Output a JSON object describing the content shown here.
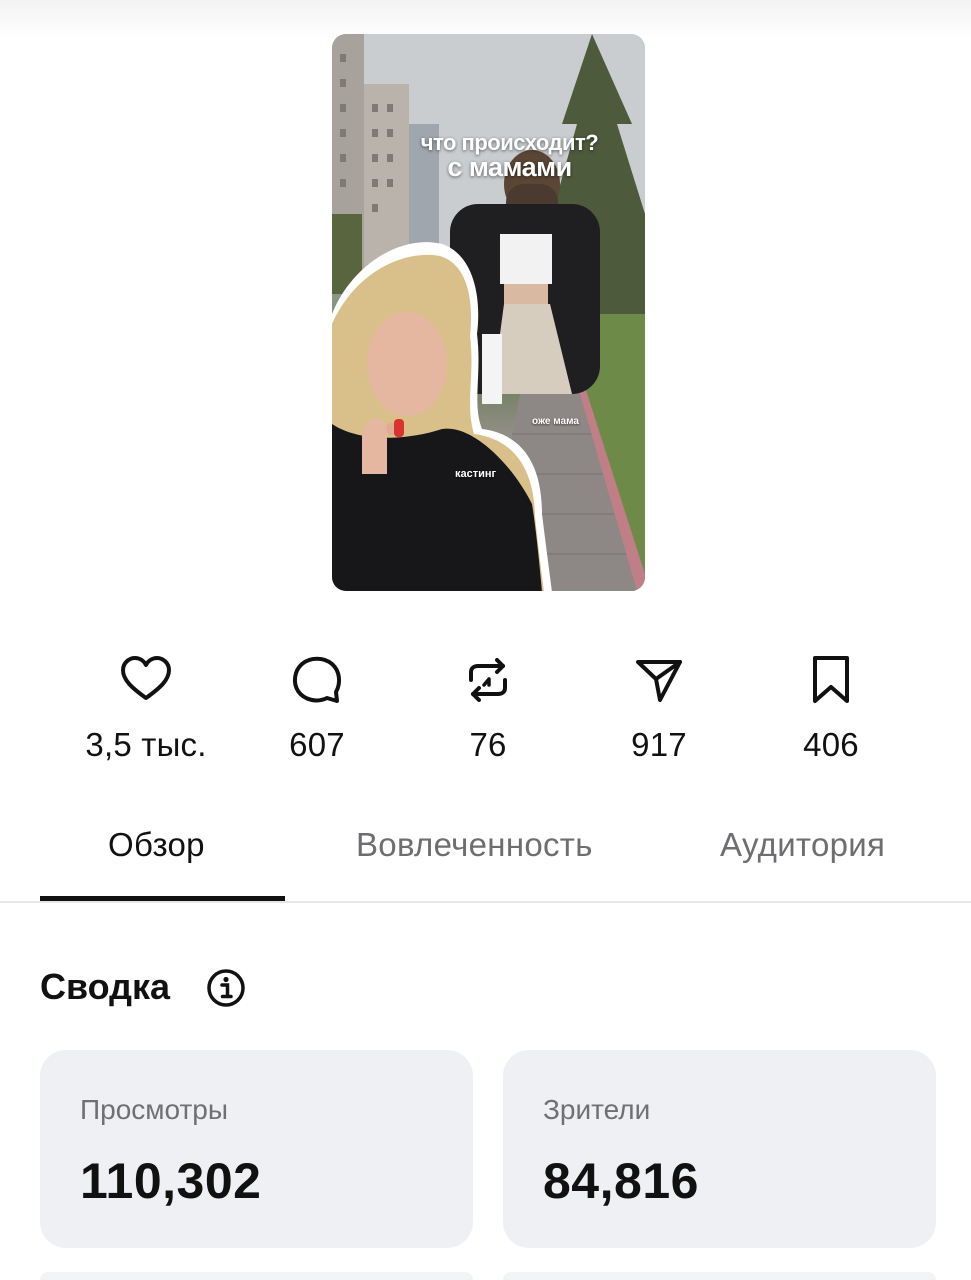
{
  "thumbnail": {
    "caption_line1": "что происходит?",
    "caption_line2": "с мамами",
    "overlay_text_casting": "кастинг",
    "overlay_text_partial": "оже мама"
  },
  "stats": [
    {
      "icon": "heart-icon",
      "value": "3,5 тыс."
    },
    {
      "icon": "comment-icon",
      "value": "607"
    },
    {
      "icon": "repost-icon",
      "value": "76"
    },
    {
      "icon": "share-icon",
      "value": "917"
    },
    {
      "icon": "bookmark-icon",
      "value": "406"
    }
  ],
  "tabs": [
    {
      "label": "Обзор",
      "active": true
    },
    {
      "label": "Вовлеченность",
      "active": false
    },
    {
      "label": "Аудитория",
      "active": false
    }
  ],
  "summary": {
    "title": "Сводка",
    "cards": [
      {
        "label": "Просмотры",
        "value": "110,302"
      },
      {
        "label": "Зрители",
        "value": "84,816"
      }
    ]
  },
  "colors": {
    "text_primary": "#111111",
    "text_secondary": "#6e6e72",
    "card_background": "#eff0f3",
    "divider": "#e6e6e8"
  }
}
